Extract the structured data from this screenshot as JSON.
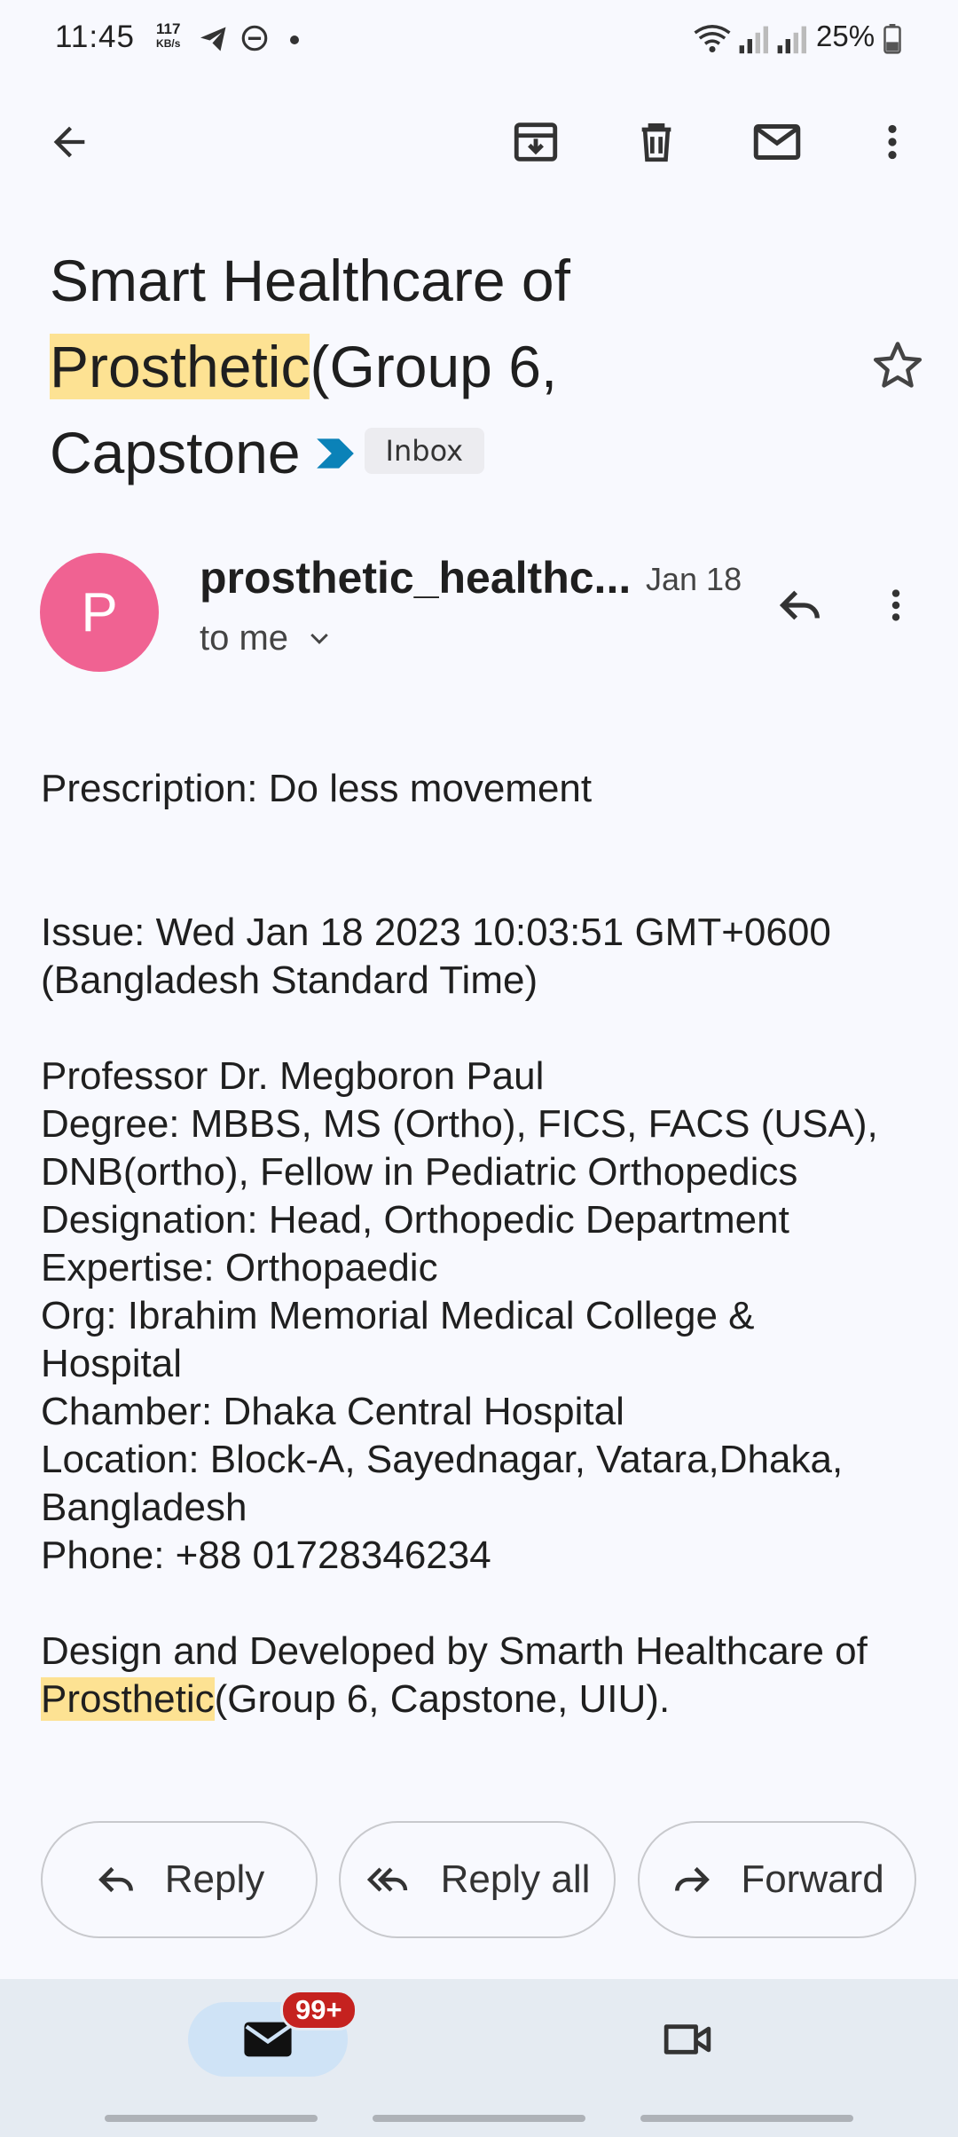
{
  "status_bar": {
    "time": "11:45",
    "net_speed_value": "117",
    "net_speed_unit": "KB/s",
    "battery": "25%"
  },
  "toolbar": {
    "icons": [
      "back-arrow-icon",
      "archive-icon",
      "delete-icon",
      "mark-unread-icon",
      "more-vert-icon"
    ]
  },
  "email": {
    "subject_line1": "Smart Healthcare of",
    "subject_highlight": "Prosthetic",
    "subject_line2_rest": "(Group 6,",
    "subject_line3": "Capstone",
    "label": "Inbox",
    "sender_initial": "P",
    "sender_name": "prosthetic_healthc...",
    "date": "Jan 18",
    "recipient": "to me",
    "body": {
      "prescription": "Prescription: Do less movement",
      "issue": "Issue: Wed Jan 18 2023 10:03:51 GMT+0600\n(Bangladesh Standard Time)",
      "doctor": "Professor Dr. Megboron Paul\nDegree: MBBS, MS (Ortho), FICS, FACS (USA),\nDNB(ortho), Fellow in Pediatric Orthopedics\nDesignation: Head, Orthopedic Department\nExpertise: Orthopaedic\nOrg: Ibrahim Memorial Medical College &\nHospital\nChamber: Dhaka Central Hospital\nLocation: Block-A, Sayednagar, Vatara,Dhaka,\nBangladesh\nPhone: +88 01728346234",
      "footer_line1": "Design and Developed by Smarth Healthcare of",
      "footer_highlight": "Prosthetic",
      "footer_rest": "(Group 6, Capstone, UIU)."
    }
  },
  "actions": {
    "reply": "Reply",
    "reply_all": "Reply all",
    "forward": "Forward"
  },
  "bottom_nav": {
    "mail_badge": "99+"
  },
  "colors": {
    "highlight": "#fde293",
    "avatar": "#f06292",
    "badge": "#c5221f",
    "label_chevron": "#0b82b8"
  }
}
